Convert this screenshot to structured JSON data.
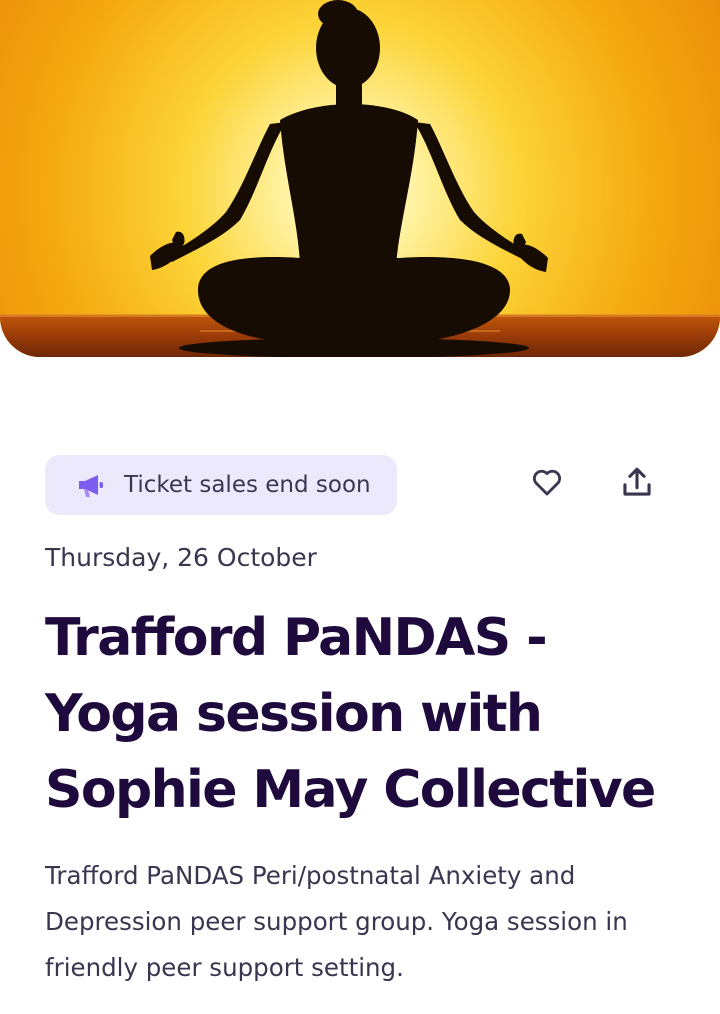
{
  "event": {
    "hero_image": "yoga-silhouette-sunset",
    "badge": {
      "icon": "megaphone-icon",
      "label": "Ticket sales end soon"
    },
    "actions": {
      "like_icon": "heart-icon",
      "share_icon": "share-icon"
    },
    "date": "Thursday, 26 October",
    "title": "Trafford PaNDAS - Yoga session with Sophie May Collective",
    "summary": "Trafford PaNDAS Peri/postnatal Anxiety and Depression peer support group. Yoga session in friendly peer support setting."
  },
  "colors": {
    "title": "#1e0a3c",
    "text": "#39364f",
    "badge_bg": "#ede9fd",
    "accent": "#7d5cf0"
  }
}
